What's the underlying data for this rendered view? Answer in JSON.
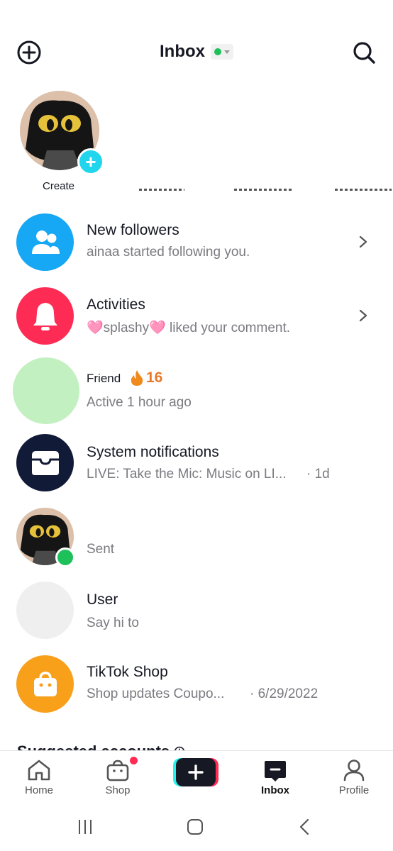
{
  "header": {
    "title": "Inbox",
    "status_color": "#1ec05a",
    "add_icon": "plus-circle-icon",
    "search_icon": "search-icon"
  },
  "stories": {
    "create_label": "Create"
  },
  "rows": [
    {
      "title": "New followers",
      "subtitle": "ainaa started following you.",
      "icon": "people-icon",
      "color": "#16a7f5"
    },
    {
      "title": "Activities",
      "subtitle": "🩷splashy🩷 liked your comment.",
      "icon": "bell-icon",
      "color": "#fe2c55"
    },
    {
      "title": "Friend",
      "streak": "16",
      "subtitle": "Active 1 hour ago",
      "color": "#c3f0c0"
    },
    {
      "title": "System notifications",
      "subtitle": "LIVE: Take the Mic: Music on LI...",
      "time": "· 1d",
      "icon": "inbox-tray-icon",
      "color": "#111a36"
    },
    {
      "title": "",
      "subtitle": "Sent"
    },
    {
      "title": "User",
      "subtitle": "Say hi to",
      "color": "#efefef"
    },
    {
      "title": "TikTok Shop",
      "subtitle": "Shop updates Coupo...",
      "time": "· 6/29/2022",
      "icon": "shopping-bag-icon",
      "color": "#f9a01b"
    }
  ],
  "suggested": {
    "label": "Suggested accounts"
  },
  "nav": {
    "home": "Home",
    "shop": "Shop",
    "inbox": "Inbox",
    "profile": "Profile"
  }
}
